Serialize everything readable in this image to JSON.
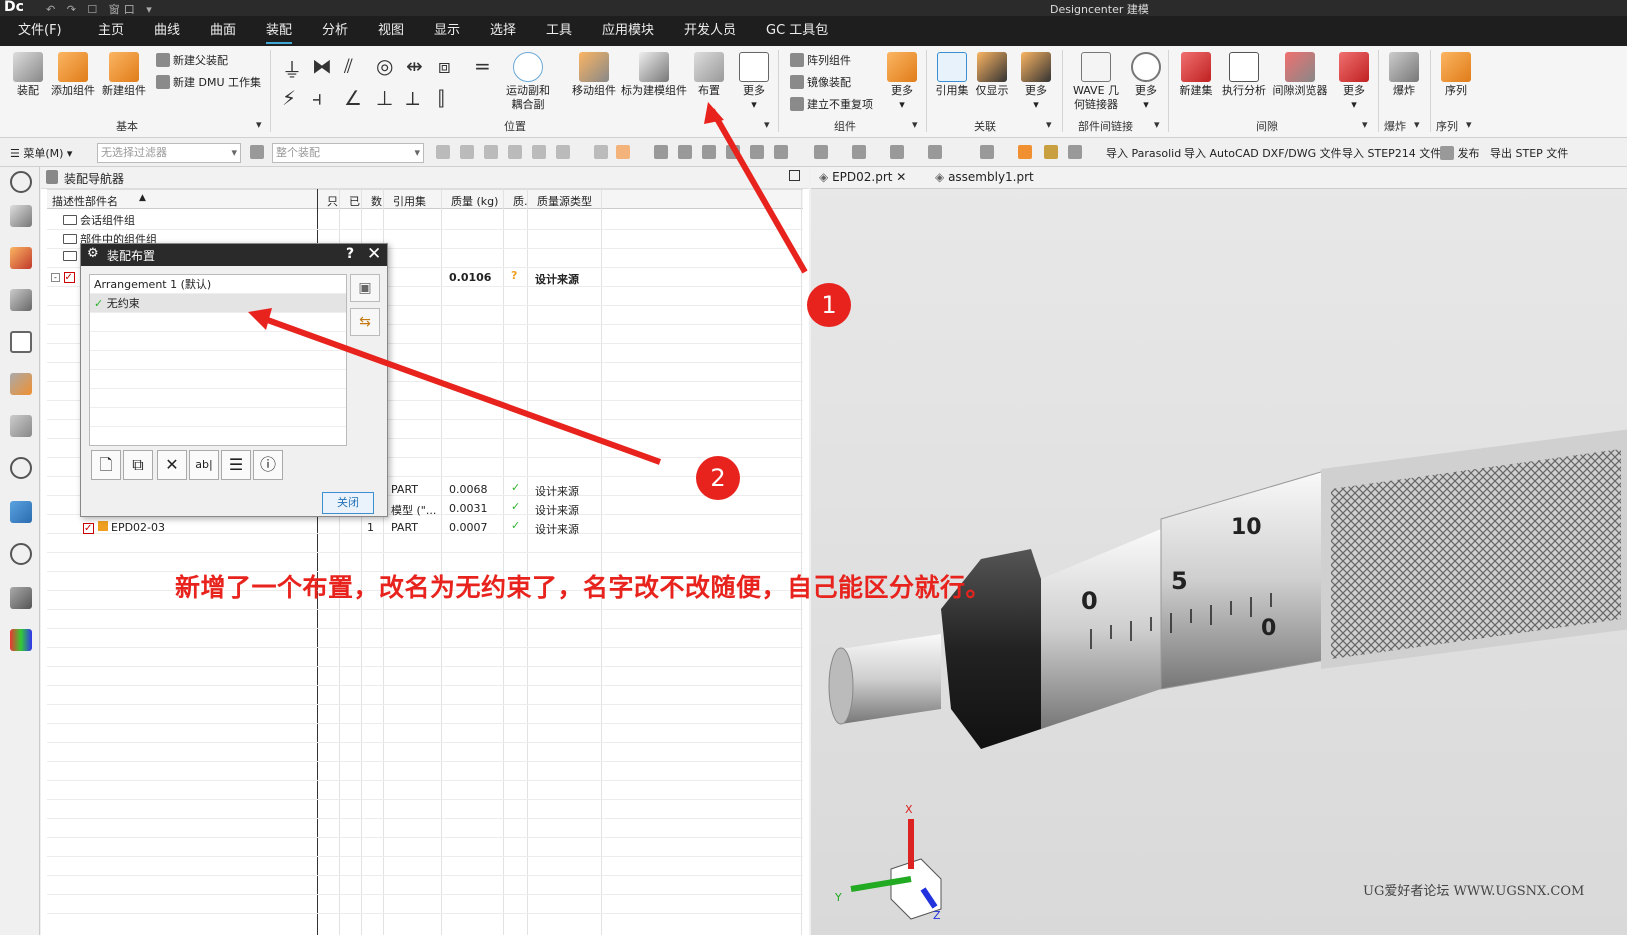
{
  "app": {
    "logo": "Dc",
    "window_title": "Designcenter 建模",
    "quick_access": "↶ ↷ ☐ 窗口 ▾"
  },
  "menu": [
    "文件(F)",
    "主页",
    "曲线",
    "曲面",
    "装配",
    "分析",
    "视图",
    "显示",
    "选择",
    "工具",
    "应用模块",
    "开发人员",
    "GC 工具包"
  ],
  "ribbon": {
    "basic": {
      "assembly": "装配",
      "add_component": "添加组件",
      "new_component": "新建组件",
      "new_parent": "新建父装配",
      "new_dmu": "新建 DMU 工作集",
      "group": "基本"
    },
    "position": {
      "motion_pair_1": "运动副和",
      "motion_pair_2": "耦合副",
      "move_component": "移动组件",
      "mark_constraint": "标为建模组件",
      "arrangement": "布置",
      "more": "更多",
      "group": "位置"
    },
    "components": {
      "array": "阵列组件",
      "mirror": "镜像装配",
      "nonrepeat": "建立不重复项",
      "more": "更多",
      "group": "组件"
    },
    "association": {
      "ref_set": "引用集",
      "show_only": "仅显示",
      "more": "更多",
      "group": "关联"
    },
    "interpart": {
      "wave_1": "WAVE 几",
      "wave_2": "何链接器",
      "more": "更多",
      "group": "部件间链接"
    },
    "clearance": {
      "new_set": "新建集",
      "run_analysis": "执行分析",
      "clearance_browser": "间隙浏览器",
      "more": "更多",
      "group": "间隙"
    },
    "explode": {
      "label": "爆炸",
      "group": "爆炸"
    },
    "sequence": {
      "label": "序列",
      "group": "序列"
    }
  },
  "toolbar2": {
    "menu": "菜单(M) ▾",
    "filter_placeholder": "无选择过滤器",
    "scope_placeholder": "整个装配",
    "import_parasolid": "导入 Parasolid",
    "import_autocad": "导入 AutoCAD DXF/DWG 文件",
    "import_step214": "导入 STEP214 文件",
    "publish": "发布",
    "export_step": "导出 STEP 文件"
  },
  "navigator": {
    "title": "装配导航器",
    "columns": [
      "描述性部件名",
      "只",
      "已",
      "数",
      "引用集",
      "质量 (kg)",
      "质.",
      "质量源类型"
    ],
    "tree": [
      "会话组件组",
      "部件中的组件组"
    ],
    "root_mass": "0.0106",
    "root_source": "设计来源",
    "rows": [
      {
        "name": "",
        "ref": "PART",
        "mass": "0.0068",
        "source": "设计来源"
      },
      {
        "name": "",
        "ref": "模型 (\"...",
        "mass": "0.0031",
        "source": "设计来源"
      },
      {
        "name": "EPD02-03",
        "count": "1",
        "ref": "PART",
        "mass": "0.0007",
        "source": "设计来源"
      }
    ]
  },
  "dialog": {
    "title": "装配布置",
    "help": "?",
    "items": [
      "Arrangement 1 (默认)",
      "无约束"
    ],
    "close": "关闭"
  },
  "viewport": {
    "tabs": [
      "EPD02.prt",
      "assembly1.prt"
    ],
    "scale_numbers": [
      "10",
      "5",
      "0",
      "0"
    ],
    "axis_labels": [
      "X",
      "Y",
      "Z"
    ]
  },
  "annotation": {
    "caption": "新增了一个布置，改名为无约束了，名字改不改随便，自己能区分就行。",
    "badge1": "1",
    "badge2": "2",
    "watermark": "UG爱好者论坛 WWW.UGSNX.COM"
  },
  "colors": {
    "accent": "#3fa6d6",
    "annotation": "#e8231d",
    "check": "#2db32d",
    "dark_bar": "#1e1e1e"
  }
}
